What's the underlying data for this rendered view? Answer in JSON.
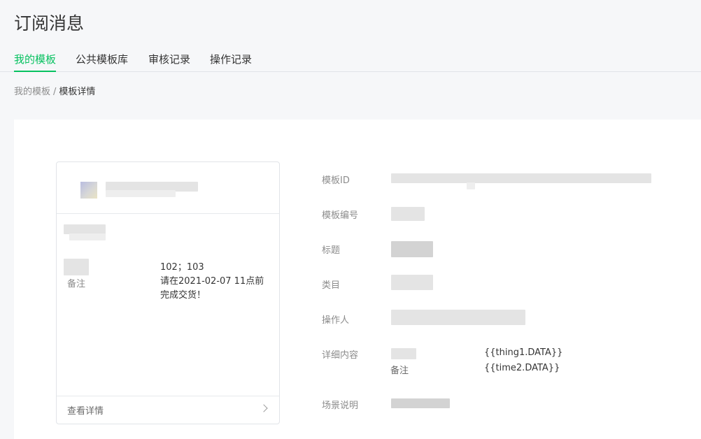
{
  "page": {
    "title": "订阅消息"
  },
  "tabs": [
    {
      "label": "我的模板",
      "active": true
    },
    {
      "label": "公共模板库",
      "active": false
    },
    {
      "label": "审核记录",
      "active": false
    },
    {
      "label": "操作记录",
      "active": false
    }
  ],
  "breadcrumb": {
    "parent": "我的模板",
    "separator": "/",
    "current": "模板详情"
  },
  "preview": {
    "rows": [
      {
        "label": "",
        "value": "102；103"
      },
      {
        "label": "备注",
        "value": "请在2021-02-07 11点前完成交货！"
      }
    ],
    "footer_label": "查看详情",
    "footer_icon": "chevron-right-icon"
  },
  "details": {
    "template_id_label": "模板ID",
    "template_no_label": "模板编号",
    "title_label": "标题",
    "category_label": "类目",
    "operator_label": "操作人",
    "content_label": "详细内容",
    "content_rows": [
      {
        "label": "",
        "value": "{{thing1.DATA}}"
      },
      {
        "label": "备注",
        "value": "{{time2.DATA}}"
      }
    ],
    "scene_label": "场景说明"
  },
  "colors": {
    "accent": "#07c160",
    "muted": "#8c8c8c",
    "text": "#353535"
  }
}
